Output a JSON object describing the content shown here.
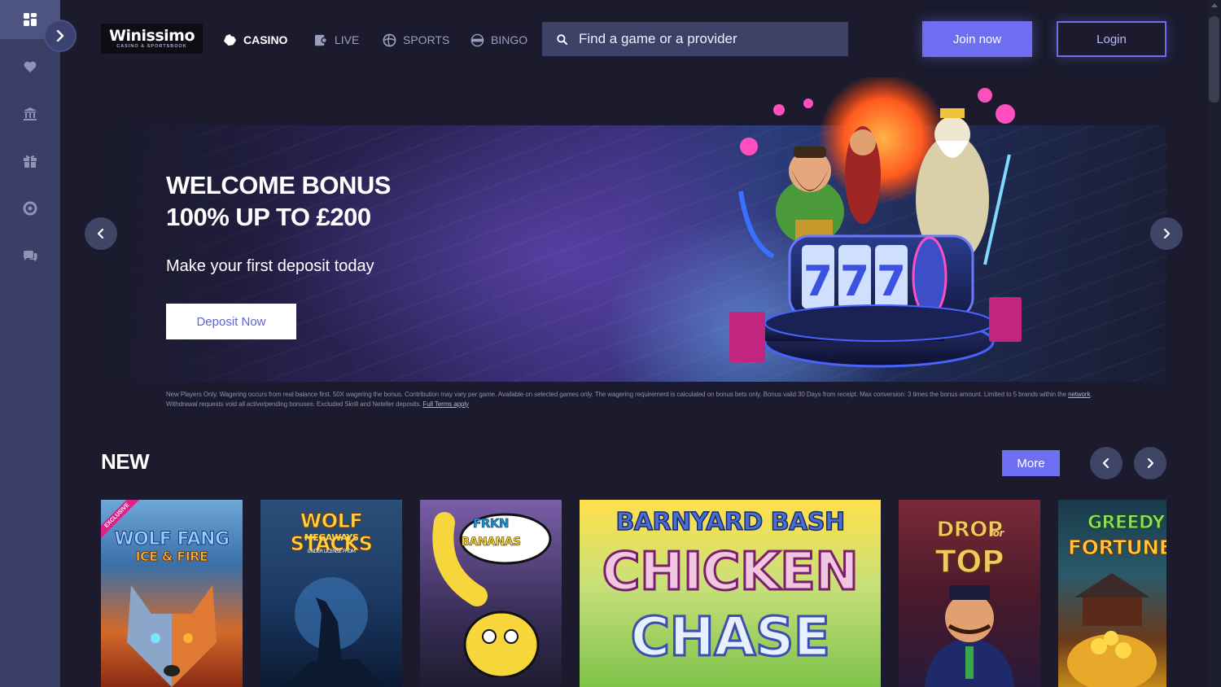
{
  "brand": {
    "name": "Winissimo",
    "tagline": "CASINO & SPORTSBOOK"
  },
  "sidebar": {
    "items": [
      {
        "icon": "dashboard-icon",
        "active": true
      },
      {
        "icon": "heart-icon",
        "active": false
      },
      {
        "icon": "bank-icon",
        "active": false
      },
      {
        "icon": "gift-icon",
        "active": false
      },
      {
        "icon": "lifebuoy-icon",
        "active": false
      },
      {
        "icon": "chat-icon",
        "active": false
      }
    ]
  },
  "nav": {
    "casino": "CASINO",
    "live": "LIVE",
    "sports": "SPORTS",
    "bingo": "BINGO"
  },
  "search": {
    "placeholder": "Find a game or a provider"
  },
  "auth": {
    "join": "Join now",
    "login": "Login"
  },
  "hero": {
    "title_line1": "WELCOME BONUS",
    "title_line2": "100% UP TO £200",
    "subtitle": "Make your first deposit today",
    "cta": "Deposit Now"
  },
  "terms": {
    "text1": "New Players Only. Wagering occurs from real balance first. 50X wagering the bonus. Contribution may vary per game. Available on selected games only. The wagering requirement is calculated on bonus bets only. Bonus valid 30 Days from receipt. Max conversion: 3 times the bonus amount. Limited to 5 brands within the",
    "link1": "network",
    "text2": ". Withdrawal requests void all active/pending bonuses. Excluded Skrill and Neteller deposits.",
    "link2": "Full Terms apply"
  },
  "new_section": {
    "title": "NEW",
    "more": "More",
    "games": [
      {
        "title_line1": "WOLF FANG",
        "title_line2": "ICE & FIRE",
        "badge": "EXCLUSIVE"
      },
      {
        "title_line1": "WOLF STACKS",
        "title_line2": "MEGAWAYS",
        "note": "UNDER LICENSE FROM"
      },
      {
        "title_line1": "FRKN",
        "title_line2": "BANANAS"
      },
      {
        "title_line1": "BARNYARD BASH",
        "title_line2": "CHICKEN",
        "title_line3": "CHASE"
      },
      {
        "title_line1": "DROP",
        "title_line2": "for",
        "title_line3": "TOP"
      },
      {
        "title_line1": "GREEDY",
        "title_line2": "FORTUNE P"
      }
    ]
  },
  "colors": {
    "accent": "#6d6ff0",
    "sidebar": "#3a3f66",
    "background": "#1b1b2d"
  }
}
